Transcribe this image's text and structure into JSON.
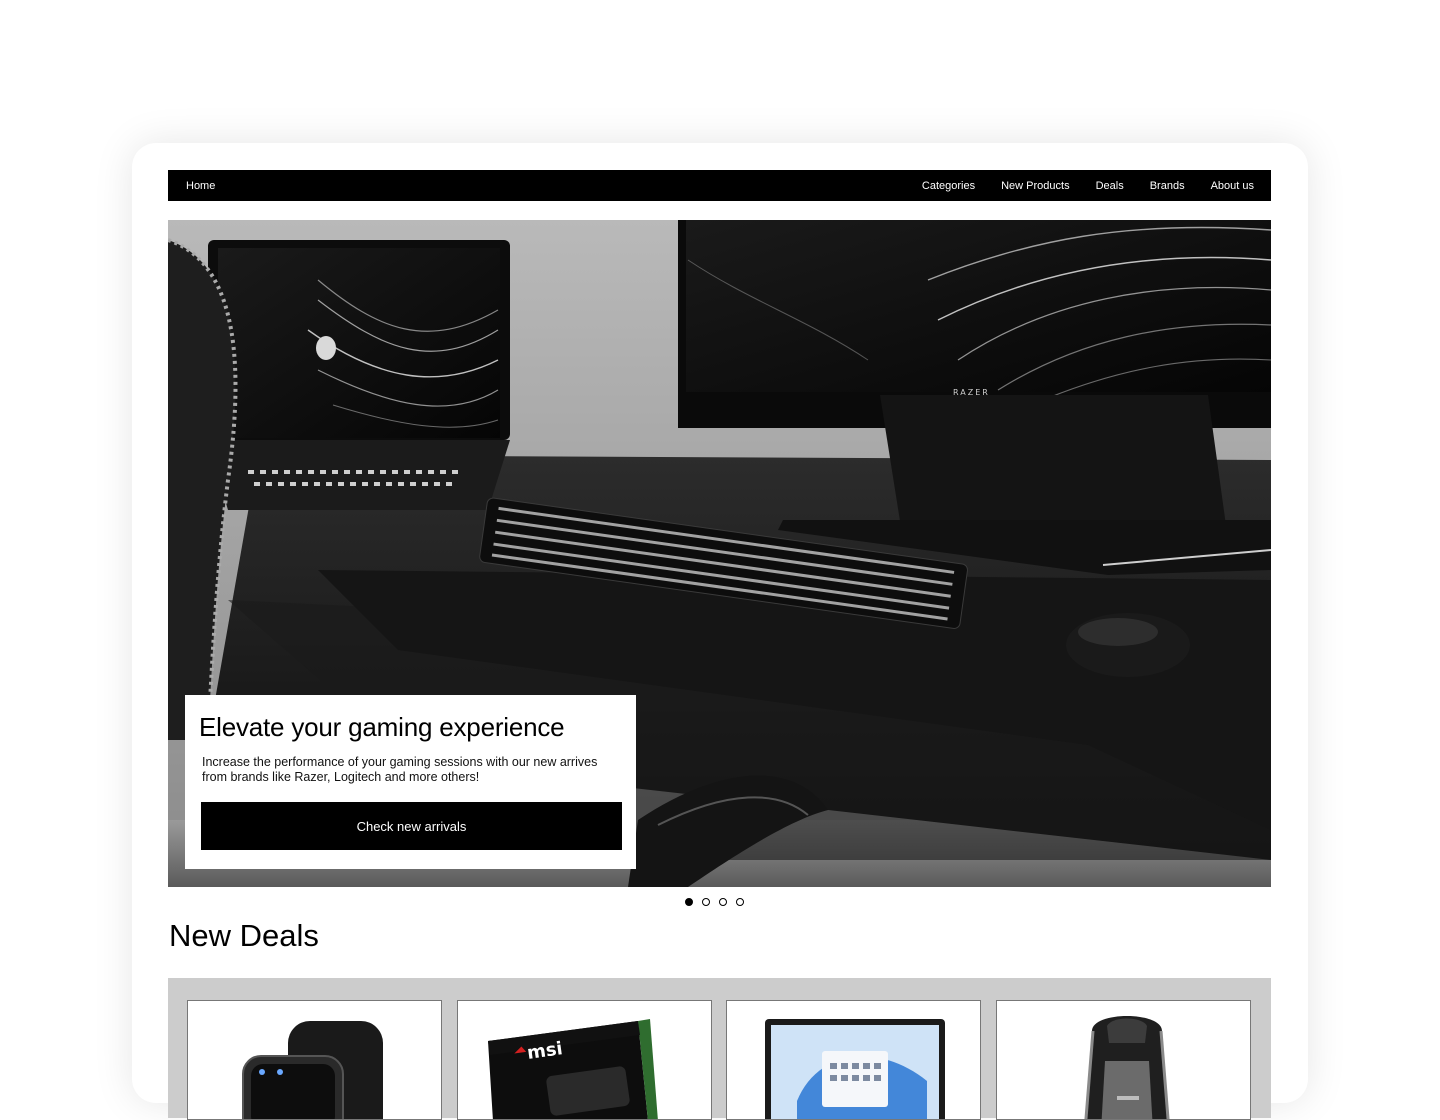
{
  "nav": {
    "home": "Home",
    "links": [
      "Categories",
      "New Products",
      "Deals",
      "Brands",
      "About us"
    ]
  },
  "hero": {
    "title": "Elevate your gaming experience",
    "description": "Increase the performance of your gaming sessions with our new arrives from brands like Razer, Logitech and more others!",
    "cta": "Check new arrivals",
    "slides_total": 4,
    "active_slide": 1,
    "monitor_brand": "RAZER"
  },
  "deals": {
    "title": "New Deals",
    "products": [
      {
        "image": "smartwatch"
      },
      {
        "image": "msi-graphics-card-box",
        "brand": "msi"
      },
      {
        "image": "laptop"
      },
      {
        "image": "gaming-chair"
      }
    ]
  }
}
